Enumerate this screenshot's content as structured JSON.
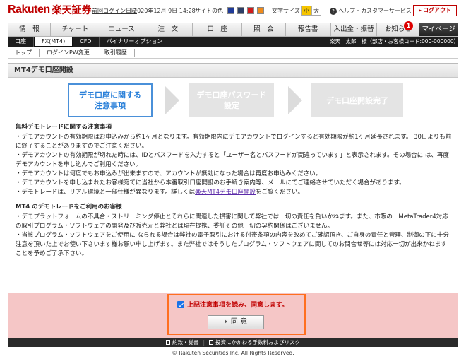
{
  "header": {
    "logo_brand": "Rakuten",
    "logo_name": "楽天証券",
    "last_login_label": "前回ログイン日時",
    "last_login_value": "2020年12月 9日 14:28",
    "site_color_label": "サイトの色",
    "site_colors": [
      "#1f3b99",
      "#2c3e66",
      "#d01a1a",
      "#f08a1a"
    ],
    "font_size_label": "文字サイズ",
    "font_small": "小",
    "font_large": "大",
    "help_label": "ヘルプ・カスタマーサービス",
    "logout_label": "ログアウト"
  },
  "main_nav": {
    "items": [
      "情　報",
      "チャート",
      "ニュース",
      "注　文",
      "口　座",
      "照　会",
      "報告書",
      "入出金・振替",
      "お知らせ",
      "マイページ"
    ],
    "notification_count": "1"
  },
  "sub_nav": {
    "items": [
      "口座",
      "FX(MT4)",
      "CFD",
      "バイナリーオプション"
    ],
    "user_info": "楽天　太郎　様（部店・お客様コード:000-000000）"
  },
  "tertiary_nav": {
    "items": [
      "トップ",
      "ログインPW変更",
      "取引履歴"
    ]
  },
  "page": {
    "title": "MT4デモ口座開設"
  },
  "steps": [
    {
      "line1": "デモ口座に関する",
      "line2": "注意事項"
    },
    {
      "line1": "デモ口座パスワード",
      "line2": "設定"
    },
    {
      "line1": "デモ口座開設完了",
      "line2": ""
    }
  ],
  "notes": {
    "heading1": "無料デモトレードに関する注意事項",
    "p1": "・デモアカウントの有効期限はお申込みから約1ヶ月となります。有効期限内にデモアカウントでログインすると有効期限が約1ヶ月延長されます。 30日よりも前に終了することがありますのでご注意ください。",
    "p2": "・デモアカウントの有効期限が切れた時には、IDとパスワードを入力すると「ユーザー名とパスワードが間違っています」と表示されます。その場合に は、再度デモアカウントを申し込んでご利用ください。",
    "p3": "・デモアカウントは何度でもお申込みが出来ますので、アカウントが無効になった場合は再度お申込みください。",
    "p4": "・デモアカウントを申し込まれたお客様宛てに当社から本番取引口座開設のお手続き案内等、メールにてご連絡させていただく場合があります。",
    "p5_prefix": "・デモトレードは、リアル環境と一部仕様が異なります。詳しくは",
    "p5_link": "楽天MT4デモ口座開設",
    "p5_suffix": "をご覧ください。",
    "heading2": "MT4 のデモトレードをご利用のお客様",
    "p6": "・デモプラットフォームの不具合・ストリーミング停止とそれらに関連した損害に関して弊社では一切の責任を負いかねます。また、市販の　MetaTrader4対応の取引プログラム・ソフトウェアの開発及び販売元と弊社とは現在提携、委託その他一切の契約関係はございません。",
    "p7": "・当該プログラム・ソフトウェアをご使用に なられる場合は弊社の電子取引における付帯条項の内容を改めてご確認頂き、ご自身の責任と管理、制御の下に十分注意を頂いた上でお使い下さいます様お願い申し上げます。また弊社ではそうしたプログラム・ソフトウェアに関してのお問合せ等には対応一切が出来かねますことを予めご了承下さい。"
  },
  "agreement": {
    "checkbox_label": "上記注意事項を読み、同意します。",
    "checked": true,
    "button_label": "同 意"
  },
  "footer": {
    "link1": "約款・覚書",
    "link2": "投資にかかわる手数料およびリスク",
    "copyright": "© Rakuten Securities,Inc. All Rights Reserved."
  }
}
